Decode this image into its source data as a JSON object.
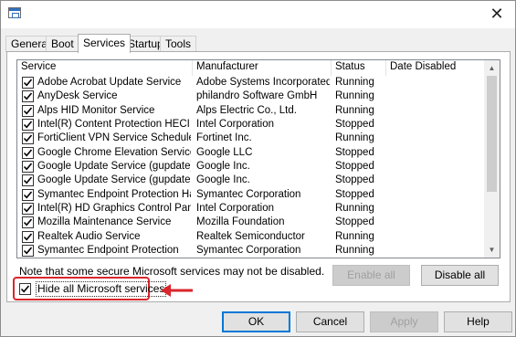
{
  "window": {
    "close_glyph": "✕"
  },
  "tabs": [
    {
      "label": "General",
      "active": false
    },
    {
      "label": "Boot",
      "active": false
    },
    {
      "label": "Services",
      "active": true
    },
    {
      "label": "Startup",
      "active": false
    },
    {
      "label": "Tools",
      "active": false
    }
  ],
  "columns": [
    "Service",
    "Manufacturer",
    "Status",
    "Date Disabled"
  ],
  "services": [
    {
      "name": "Adobe Acrobat Update Service",
      "manufacturer": "Adobe Systems Incorporated",
      "status": "Running",
      "checked": true
    },
    {
      "name": "AnyDesk Service",
      "manufacturer": "philandro Software GmbH",
      "status": "Running",
      "checked": true
    },
    {
      "name": "Alps HID Monitor Service",
      "manufacturer": "Alps Electric Co., Ltd.",
      "status": "Running",
      "checked": true
    },
    {
      "name": "Intel(R) Content Protection HECI ...",
      "manufacturer": "Intel Corporation",
      "status": "Stopped",
      "checked": true
    },
    {
      "name": "FortiClient VPN Service Scheduler",
      "manufacturer": "Fortinet Inc.",
      "status": "Running",
      "checked": true
    },
    {
      "name": "Google Chrome Elevation Service",
      "manufacturer": "Google LLC",
      "status": "Stopped",
      "checked": true
    },
    {
      "name": "Google Update Service (gupdate)",
      "manufacturer": "Google Inc.",
      "status": "Stopped",
      "checked": true
    },
    {
      "name": "Google Update Service (gupdatem)",
      "manufacturer": "Google Inc.",
      "status": "Stopped",
      "checked": true
    },
    {
      "name": "Symantec Endpoint Protection Har...",
      "manufacturer": "Symantec Corporation",
      "status": "Stopped",
      "checked": true
    },
    {
      "name": "Intel(R) HD Graphics Control Pane...",
      "manufacturer": "Intel Corporation",
      "status": "Running",
      "checked": true
    },
    {
      "name": "Mozilla Maintenance Service",
      "manufacturer": "Mozilla Foundation",
      "status": "Stopped",
      "checked": true
    },
    {
      "name": "Realtek Audio Service",
      "manufacturer": "Realtek Semiconductor",
      "status": "Running",
      "checked": true
    },
    {
      "name": "Symantec Endpoint Protection",
      "manufacturer": "Symantec Corporation",
      "status": "Running",
      "checked": true
    },
    {
      "name": "",
      "manufacturer": "",
      "status": "",
      "checked": true
    }
  ],
  "note": "Note that some secure Microsoft services may not be disabled.",
  "buttons": {
    "enable_all": "Enable all",
    "disable_all": "Disable all",
    "ok": "OK",
    "cancel": "Cancel",
    "apply": "Apply",
    "help": "Help"
  },
  "hide_ms": {
    "label": "Hide all Microsoft services",
    "checked": true
  },
  "colors": {
    "highlight": "#d9262c",
    "accent": "#0078d7"
  }
}
